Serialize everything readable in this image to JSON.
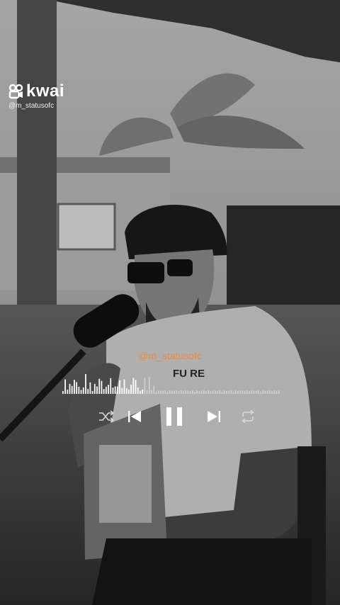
{
  "watermark": {
    "brand": "kwai",
    "handle": "@m_statusofc"
  },
  "overlay": {
    "handle": "@m_statusofc",
    "handle_color": "#f08a3c"
  },
  "shirt_text": "FU RE",
  "player": {
    "controls": [
      "shuffle-icon",
      "previous-icon",
      "pause-icon",
      "next-icon",
      "repeat-icon"
    ],
    "progress": 0.37
  },
  "colors": {
    "waveform_played": "#ffffff",
    "waveform_unplayed": "#cfcfcf"
  }
}
